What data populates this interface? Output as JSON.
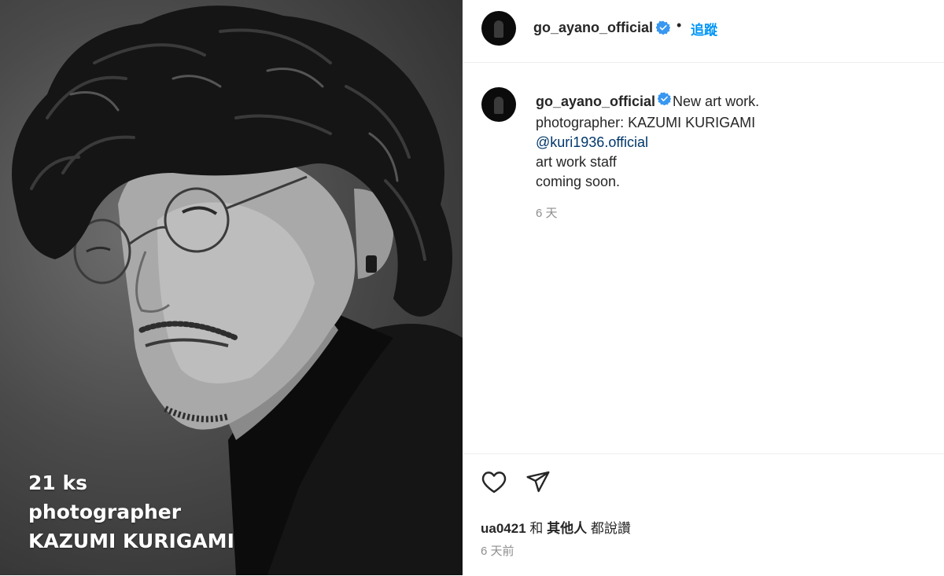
{
  "photo": {
    "overlay_line1": "21 ks",
    "overlay_line2": "photographer",
    "overlay_line3": "KAZUMI KURIGAMI"
  },
  "header": {
    "username": "go_ayano_official",
    "separator": "•",
    "follow_label": "追蹤"
  },
  "caption": {
    "username": "go_ayano_official",
    "line1": "New art work.",
    "line2": "photographer: KAZUMI KURIGAMI",
    "mention": "@kuri1936.official",
    "line4": "art work staff",
    "line5": "coming soon.",
    "time": "6 天"
  },
  "actions": {
    "liked_by_user": "ua0421",
    "liked_by_connector": " 和 ",
    "liked_by_others": "其他人",
    "liked_by_suffix": " 都說讚",
    "post_time": "6 天前"
  },
  "colors": {
    "accent": "#0095f6",
    "verified": "#3897f0",
    "mention": "#00376b",
    "muted": "#8e8e8e"
  },
  "icons": [
    "verified-badge-icon",
    "heart-icon",
    "share-icon"
  ]
}
